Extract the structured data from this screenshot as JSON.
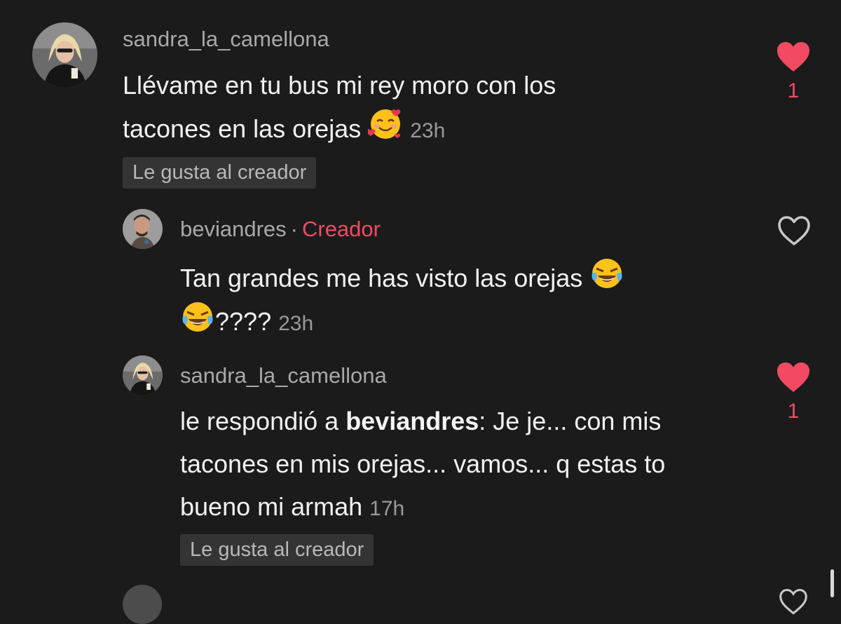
{
  "comments": [
    {
      "username": "sandra_la_camellona",
      "text_line1": "Llévame en tu bus mi rey moro con los",
      "text_line2": "tacones en las orejas",
      "emoji": "smiling-face-with-hearts-emoji",
      "time": "23h",
      "badge": "Le gusta al creador",
      "liked": true,
      "like_count": "1"
    },
    {
      "username": "beviandres",
      "separator": "·",
      "creator_label": "Creador",
      "text_line1": "Tan grandes me has visto las orejas",
      "text_line2_suffix": "????",
      "emoji": "tears-of-joy-emoji",
      "time": "23h",
      "liked": false
    },
    {
      "username": "sandra_la_camellona",
      "reply_prefix": "le respondió a",
      "reply_to": "beviandres",
      "text_line1_rest": ": Je je... con mis",
      "text_line2": "tacones en mis orejas... vamos... q estas to",
      "text_line3": "bueno mi armah",
      "time": "17h",
      "badge": "Le gusta al creador",
      "liked": true,
      "like_count": "1"
    }
  ],
  "colors": {
    "background": "#1b1b1c",
    "accent": "#f24a63",
    "username": "#a9a9a9",
    "badge_bg": "#343434"
  }
}
